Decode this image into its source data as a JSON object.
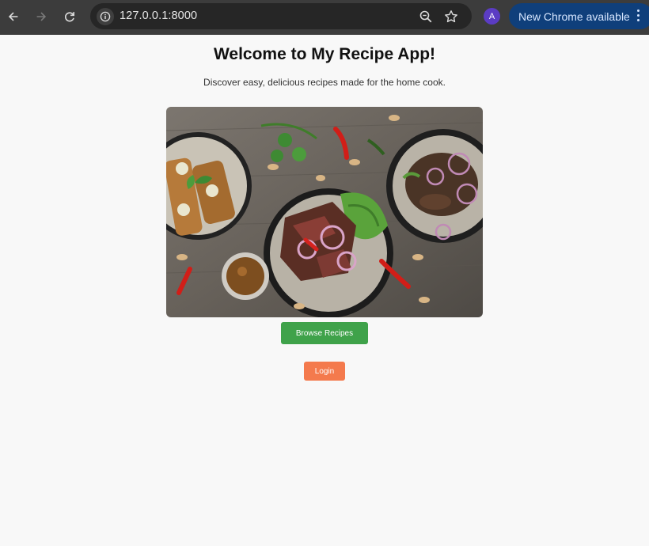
{
  "browser": {
    "url": "127.0.0.1:8000",
    "profile_initial": "A",
    "update_label": "New Chrome available",
    "icons": [
      "back-icon",
      "forward-icon",
      "reload-icon",
      "site-info-icon",
      "zoom-icon",
      "bookmark-star-icon",
      "kebab-menu-icon"
    ]
  },
  "page": {
    "title": "Welcome to My Recipe App!",
    "subtitle": "Discover easy, delicious recipes made for the home cook.",
    "browse_label": "Browse Recipes",
    "login_label": "Login"
  },
  "colors": {
    "browse_button": "#3fa24a",
    "login_button": "#f47a4d",
    "toolbar": "#3c3c3c",
    "update_pill": "#0f3f7b"
  }
}
